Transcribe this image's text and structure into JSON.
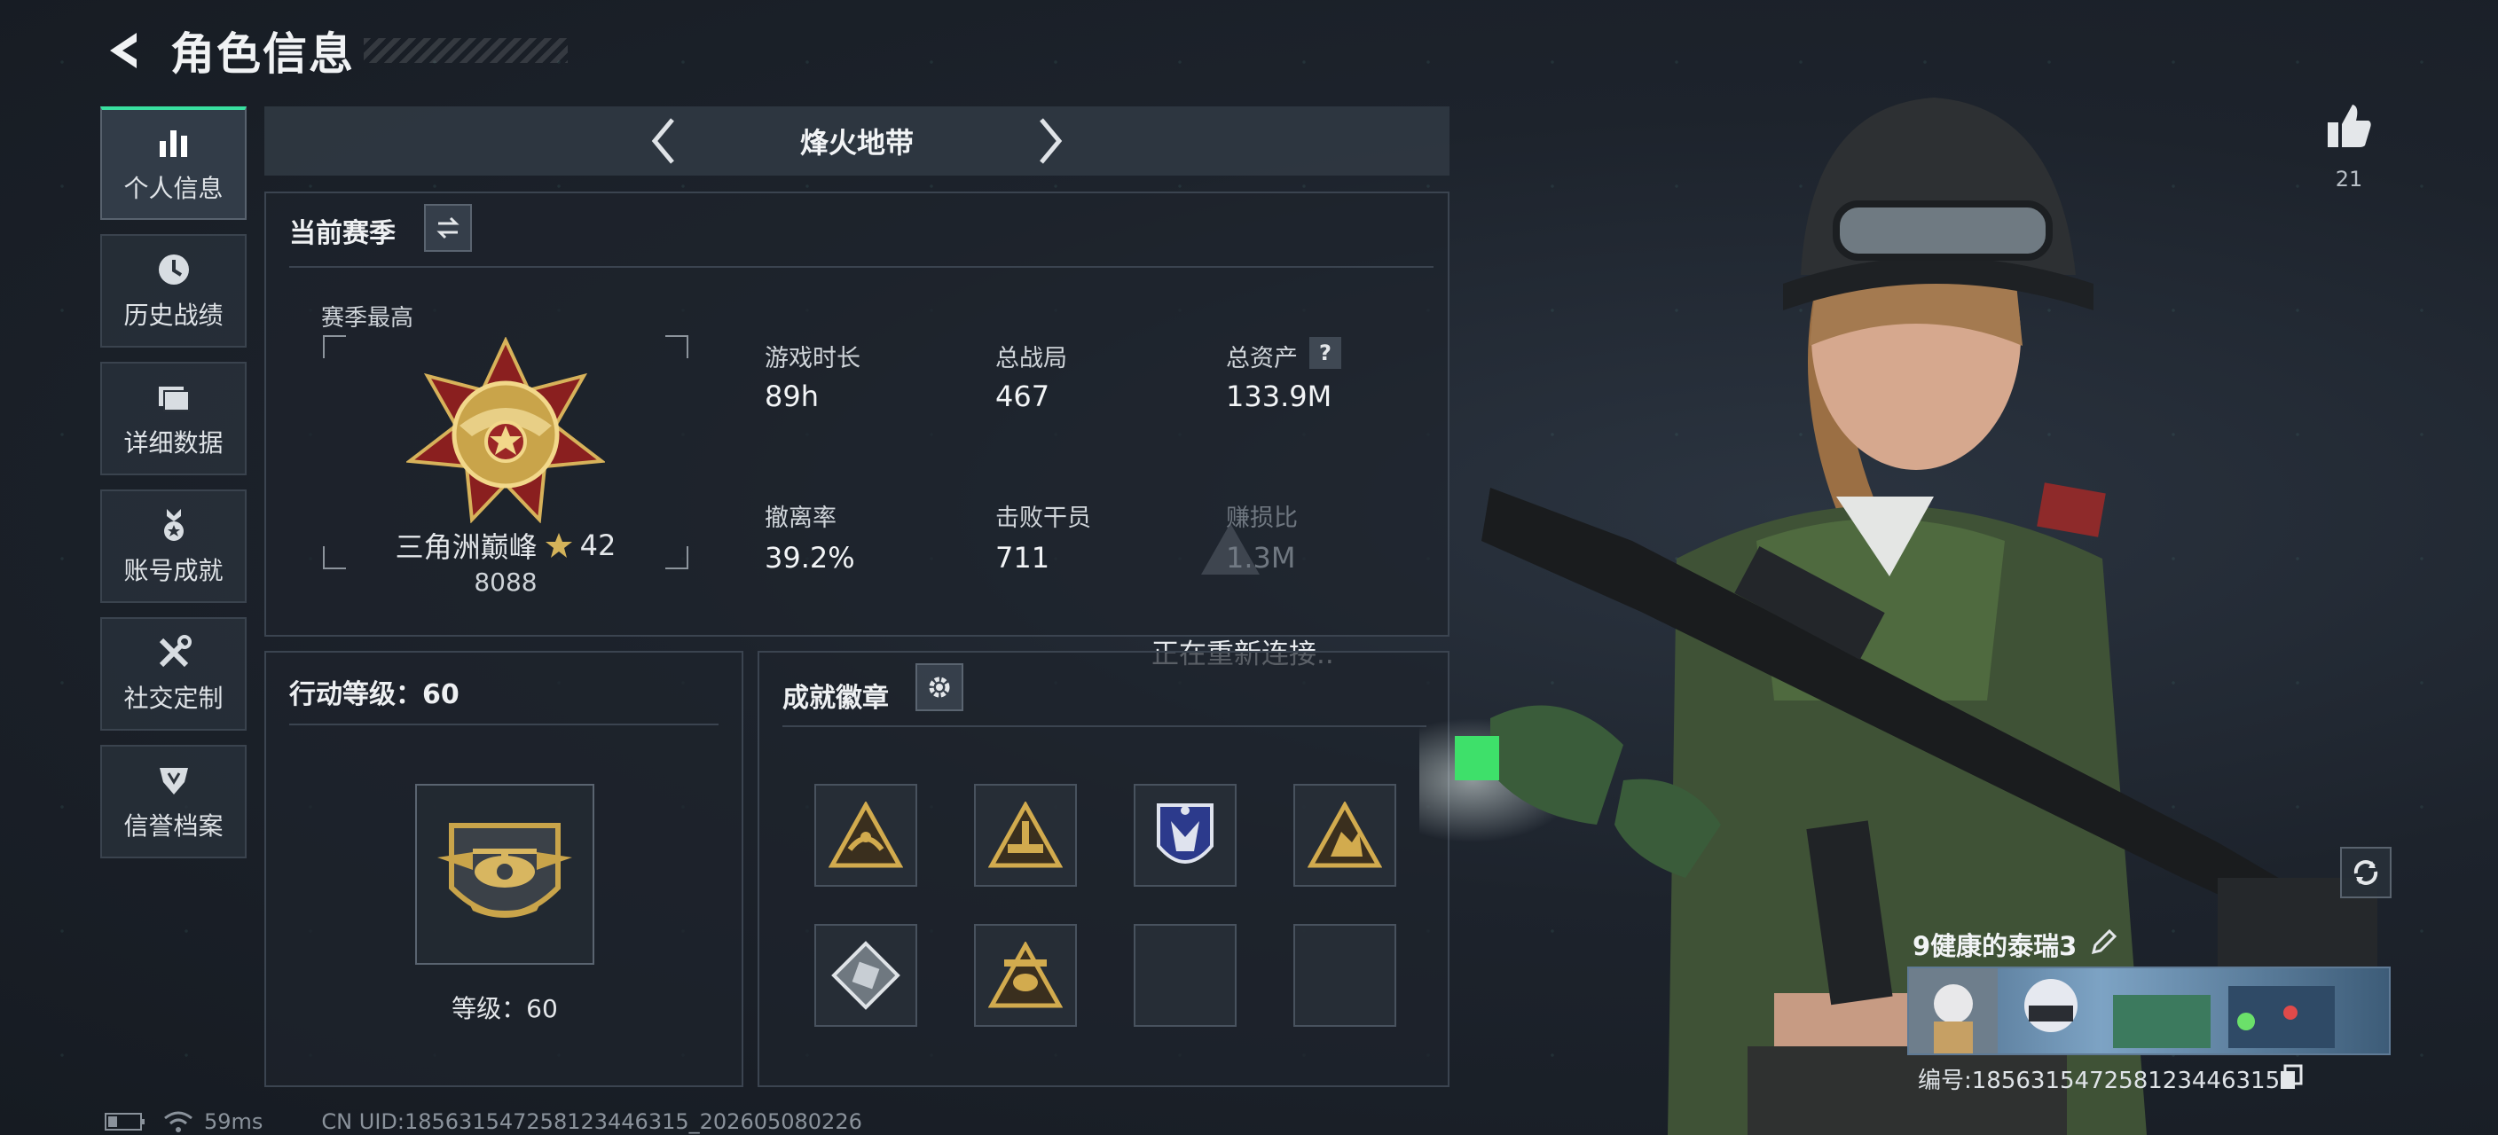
{
  "header": {
    "title": "角色信息"
  },
  "sidebar": {
    "items": [
      {
        "label": "个人信息",
        "icon": "bar-chart-icon",
        "active": true
      },
      {
        "label": "历史战绩",
        "icon": "clock-icon",
        "active": false
      },
      {
        "label": "详细数据",
        "icon": "folder-icon",
        "active": false
      },
      {
        "label": "账号成就",
        "icon": "medal-icon",
        "active": false
      },
      {
        "label": "社交定制",
        "icon": "tools-icon",
        "active": false
      },
      {
        "label": "信誉档案",
        "icon": "shield-icon",
        "active": false
      }
    ]
  },
  "mode": {
    "title": "烽火地带"
  },
  "season": {
    "title": "当前赛季",
    "best_label": "赛季最高",
    "rank_name": "三角洲巅峰",
    "rank_stars": "42",
    "rank_score": "8088",
    "stats": [
      {
        "label": "游戏时长",
        "value": "89h"
      },
      {
        "label": "总战局",
        "value": "467"
      },
      {
        "label": "总资产",
        "value": "133.9M",
        "has_help": true,
        "help_glyph": "?"
      },
      {
        "label": "撤离率",
        "value": "39.2%"
      },
      {
        "label": "击败干员",
        "value": "711"
      },
      {
        "label": "赚损比",
        "value": "1.3M"
      }
    ]
  },
  "action_level": {
    "title": "行动等级：60",
    "level_text": "等级：60"
  },
  "achievements": {
    "title": "成就徽章",
    "badges_filled": 6,
    "slots": 8
  },
  "overlay": {
    "reconnect_text": "正在重新连接.."
  },
  "profile": {
    "likes": "21",
    "name": "9健康的泰瑞3",
    "id_text": "编号:185631547258123446315"
  },
  "status": {
    "ping": "59ms",
    "uid": "CN UID:185631547258123446315_202605080226"
  },
  "colors": {
    "accent": "#39e0a0",
    "gold": "#c9a44a",
    "panel_border": "#3b4450"
  }
}
